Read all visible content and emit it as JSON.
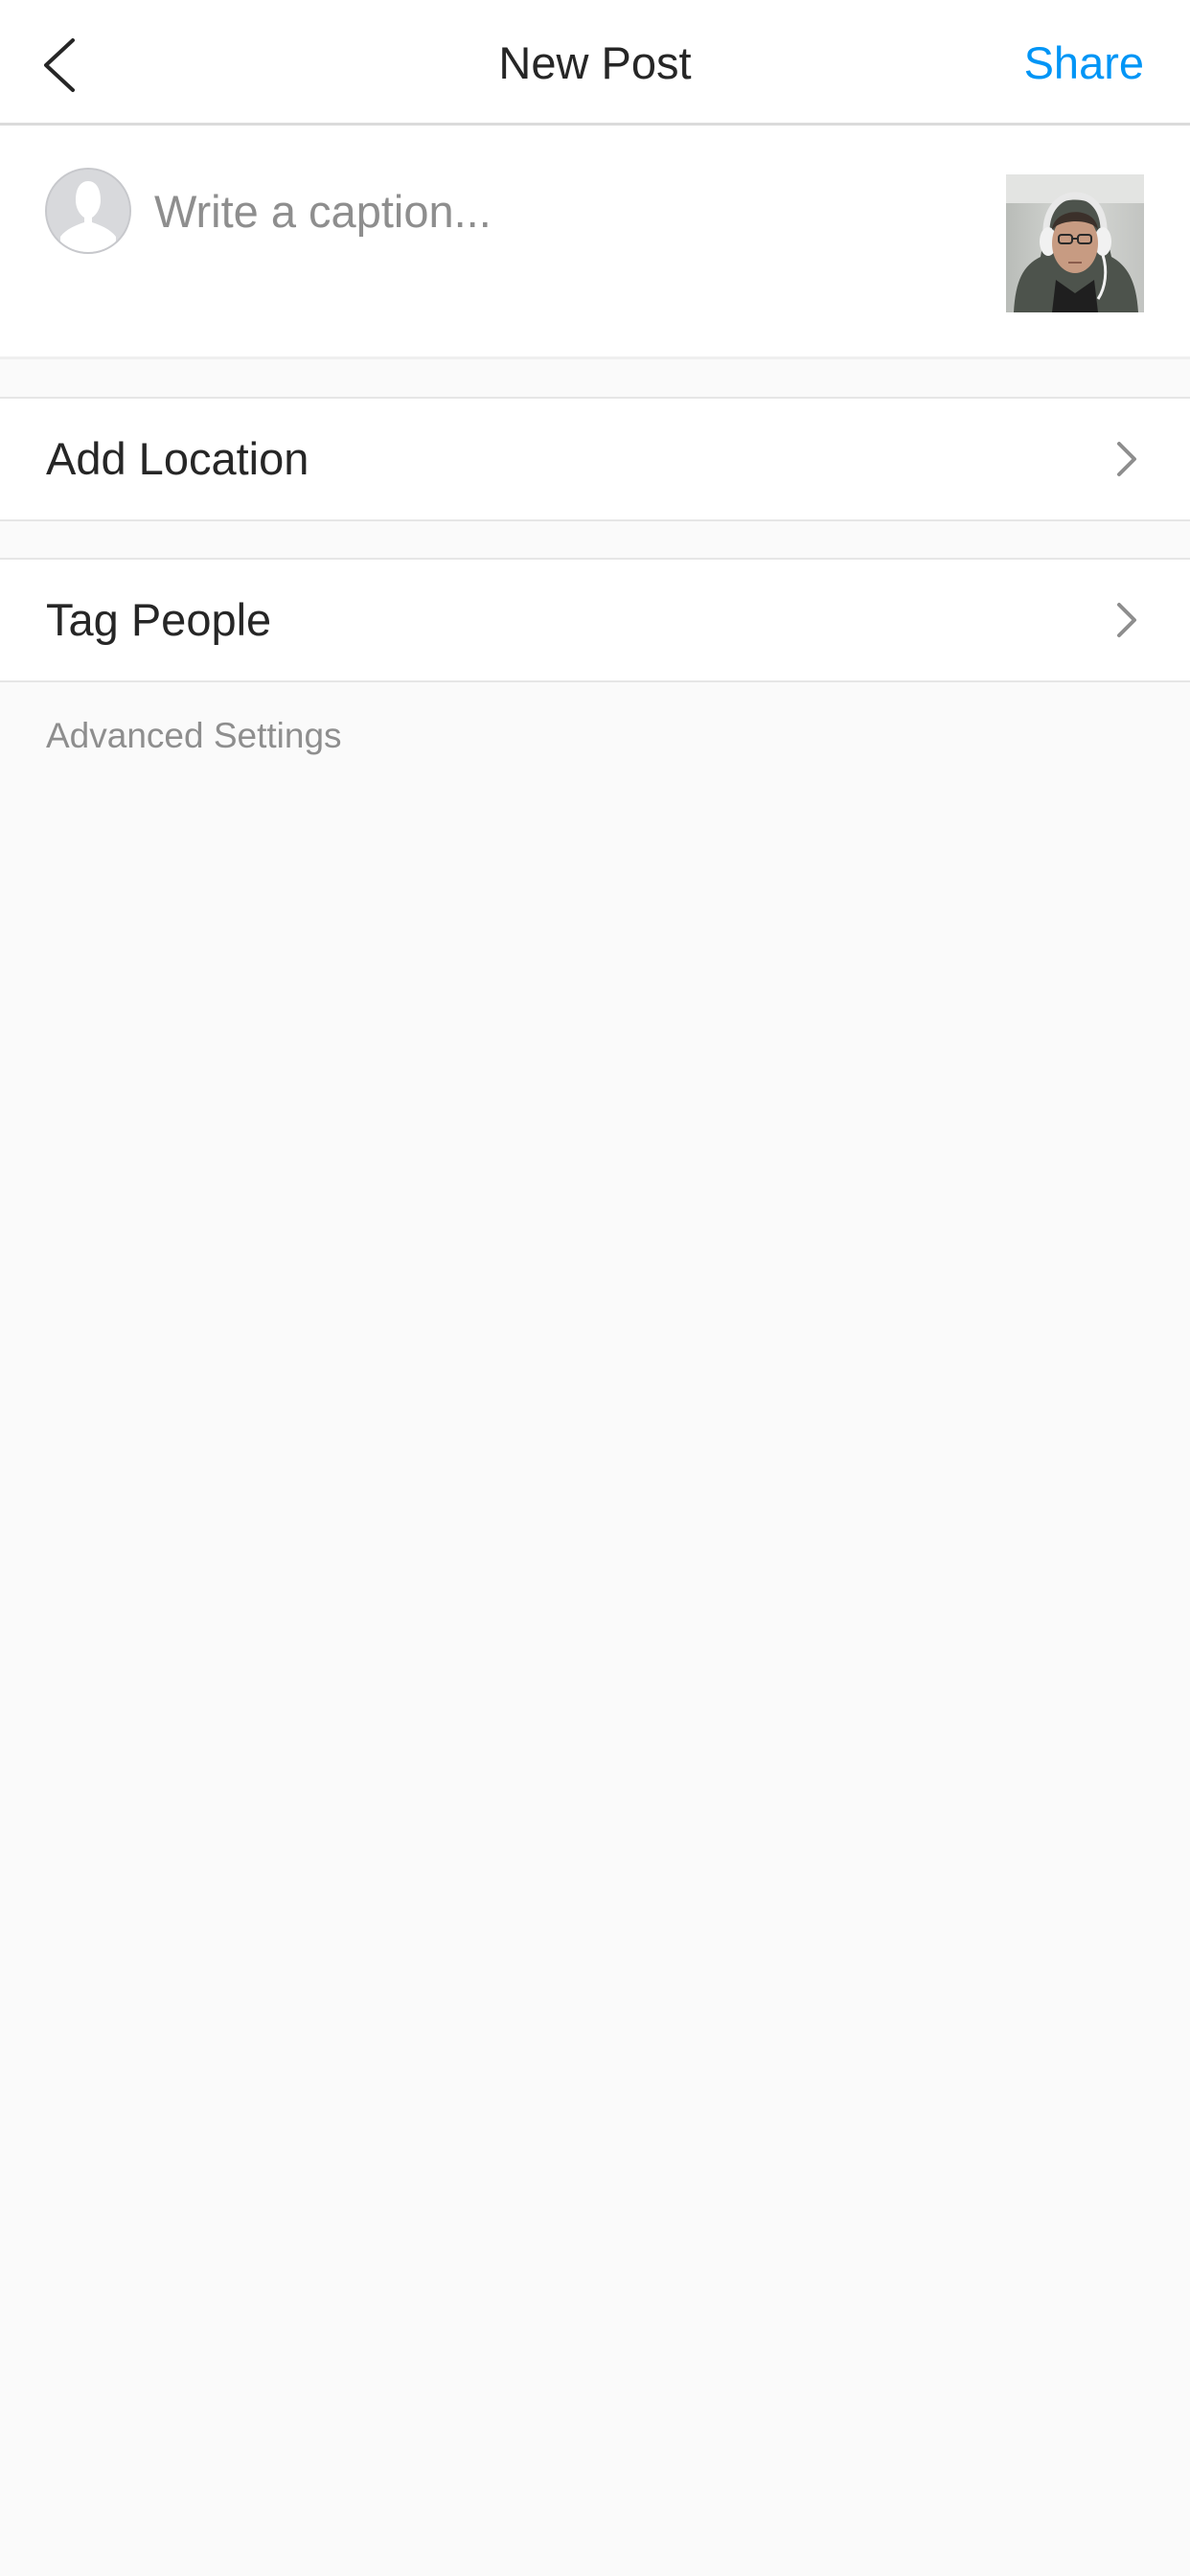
{
  "header": {
    "title": "New Post",
    "share_label": "Share",
    "back_icon": "chevron-left-icon"
  },
  "caption": {
    "placeholder": "Write a caption...",
    "value": "",
    "avatar_icon": "default-avatar-icon",
    "thumbnail": "post-photo-thumbnail"
  },
  "rows": [
    {
      "label": "Add Location",
      "icon": "chevron-right-icon"
    },
    {
      "label": "Tag People",
      "icon": "chevron-right-icon"
    }
  ],
  "advanced_settings_label": "Advanced Settings",
  "colors": {
    "accent": "#0095f6",
    "text": "#262626",
    "secondary_text": "#8e8e8e",
    "background": "#fafafa",
    "divider": "#dbdbdb"
  }
}
